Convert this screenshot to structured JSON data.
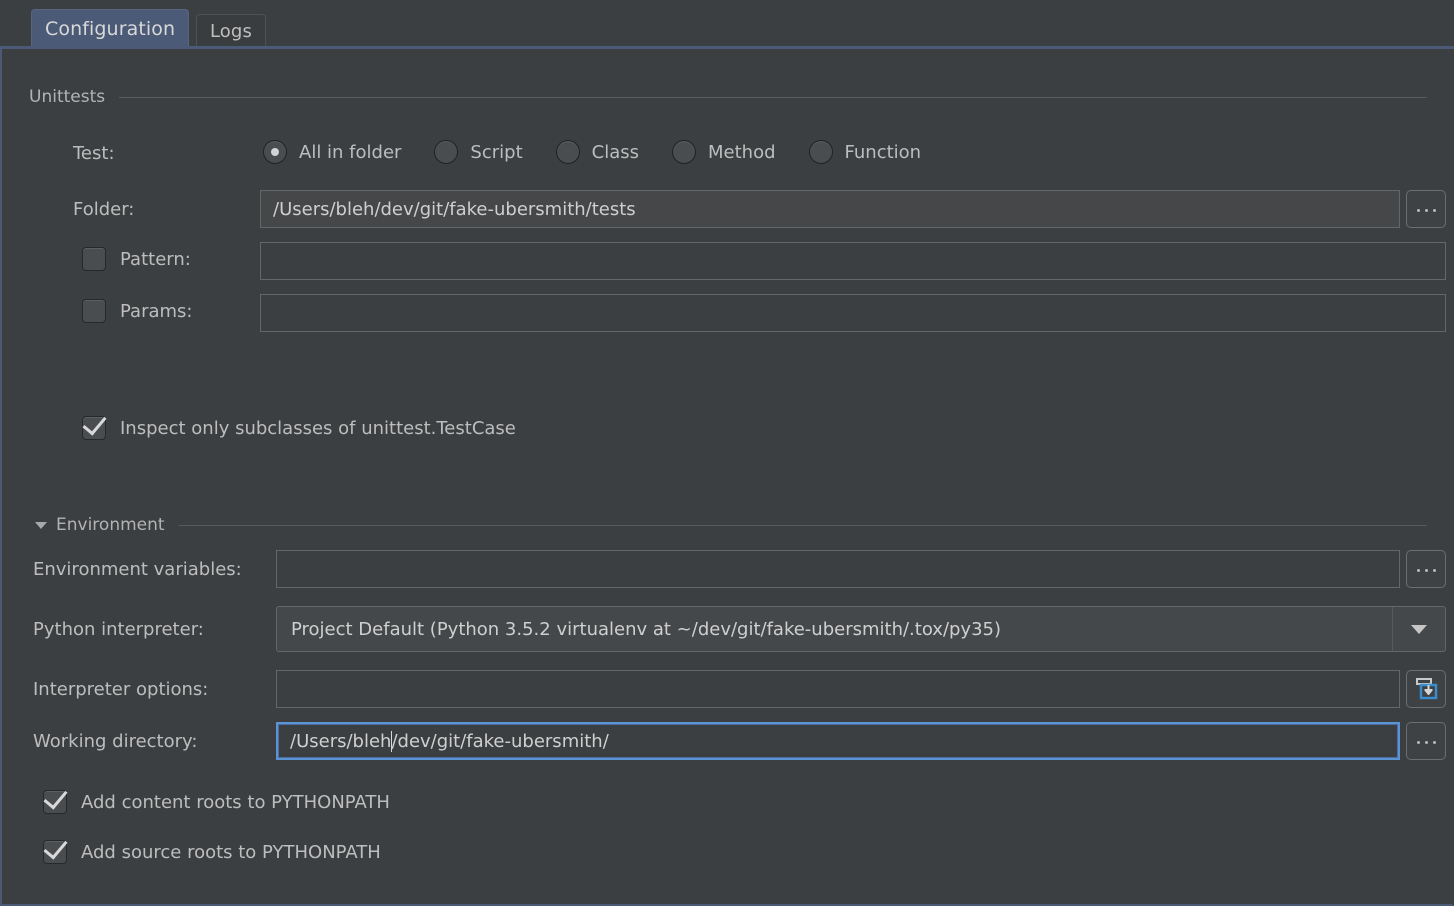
{
  "tabs": [
    {
      "label": "Configuration",
      "active": true
    },
    {
      "label": "Logs",
      "active": false
    }
  ],
  "groups": {
    "unittests_title": "Unittests",
    "environment_title": "Environment"
  },
  "unittests": {
    "test_label": "Test:",
    "test_options": [
      {
        "label": "All in folder",
        "selected": true
      },
      {
        "label": "Script",
        "selected": false
      },
      {
        "label": "Class",
        "selected": false
      },
      {
        "label": "Method",
        "selected": false
      },
      {
        "label": "Function",
        "selected": false
      }
    ],
    "folder_label": "Folder:",
    "folder_value": "/Users/bleh/dev/git/fake-ubersmith/tests",
    "pattern_label": "Pattern:",
    "pattern_value": "",
    "pattern_checked": false,
    "params_label": "Params:",
    "params_value": "",
    "params_checked": false,
    "inspect_label": "Inspect only subclasses of unittest.TestCase",
    "inspect_checked": true
  },
  "environment": {
    "env_vars_label": "Environment variables:",
    "env_vars_value": "",
    "interpreter_label": "Python interpreter:",
    "interpreter_value": "Project Default (Python 3.5.2 virtualenv at ~/dev/git/fake-ubersmith/.tox/py35)",
    "interp_options_label": "Interpreter options:",
    "interp_options_value": "",
    "working_dir_label": "Working directory:",
    "working_dir_value_before_caret": "/Users/bleh",
    "working_dir_value_after_caret": "/dev/git/fake-ubersmith/",
    "add_content_roots_label": "Add content roots to PYTHONPATH",
    "add_content_roots_checked": true,
    "add_source_roots_label": "Add source roots to PYTHONPATH",
    "add_source_roots_checked": true
  },
  "buttons": {
    "browse_label": "…",
    "expand_macro_name": "insert-macro-icon"
  },
  "colors": {
    "panel_bg": "#3c3f41",
    "active_tab_bg": "#4b5a76",
    "accent_blue": "#5b93d6",
    "text": "#bdbdbd",
    "field_border": "#646769"
  }
}
